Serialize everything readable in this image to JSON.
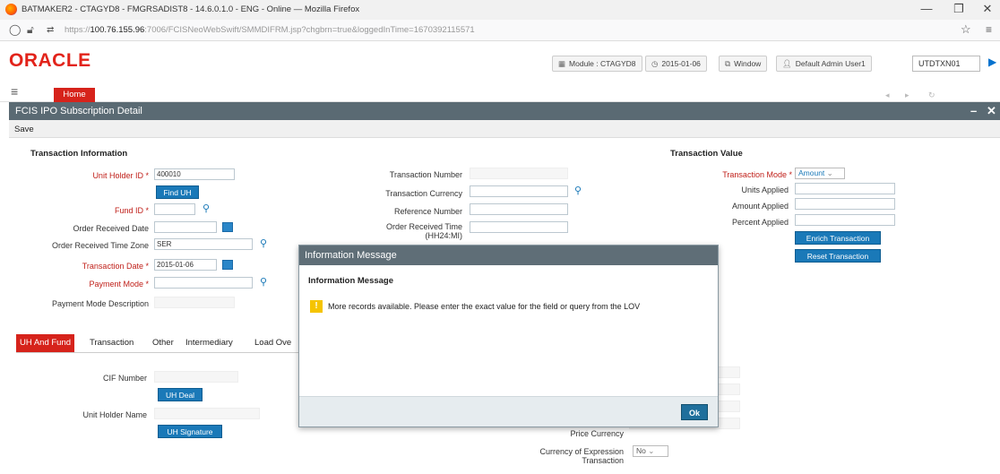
{
  "browser": {
    "window_title": "BATMAKER2 - CTAGYD8 - FMGRSADIST8 - 14.6.0.1.0 - ENG - Online — Mozilla Firefox",
    "url_prefix": "https://",
    "url_host": "100.76.155.96",
    "url_rest": ":7006/FCISNeoWebSwift/SMMDIFRM.jsp?chgbrn=true&loggedInTime=1670392115571",
    "minimize": "—",
    "maximize": "❐",
    "close": "✕"
  },
  "app": {
    "logo": "ORACLE",
    "module_label": "Module : CTAGYD8",
    "date_label": "2015-01-06",
    "window_label": "Window",
    "user_label": "Default Admin User1",
    "branch_value": "UTDTXN01",
    "home_tab": "Home"
  },
  "form": {
    "title": "FCIS IPO Subscription Detail",
    "save": "Save",
    "txn_info": {
      "heading": "Transaction Information",
      "unit_holder_id_label": "Unit Holder ID",
      "unit_holder_id_value": "400010",
      "find_uh": "Find UH",
      "fund_id_label": "Fund ID",
      "order_received_date_label": "Order Received Date",
      "order_received_tz_label": "Order Received Time Zone",
      "order_received_tz_value": "SER",
      "transaction_date_label": "Transaction Date",
      "transaction_date_value": "2015-01-06",
      "payment_mode_label": "Payment Mode",
      "payment_mode_desc_label": "Payment Mode Description"
    },
    "middle": {
      "transaction_number_label": "Transaction Number",
      "transaction_currency_label": "Transaction Currency",
      "reference_number_label": "Reference Number",
      "order_received_time_label": "Order Received Time",
      "order_received_time_sub": "(HH24:MI)"
    },
    "txn_value": {
      "heading": "Transaction Value",
      "transaction_mode_label": "Transaction Mode",
      "transaction_mode_value": "Amount",
      "units_applied_label": "Units Applied",
      "amount_applied_label": "Amount Applied",
      "percent_applied_label": "Percent Applied",
      "enrich_button": "Enrich Transaction",
      "reset_button": "Reset Transaction"
    },
    "required_star": "*",
    "subtabs": [
      "UH And Fund",
      "Transaction",
      "Other",
      "Intermediary",
      "Load Ove"
    ],
    "uh_section": {
      "cif_number_label": "CIF Number",
      "uh_deal_button": "UH Deal",
      "unit_holder_name_label": "Unit Holder Name",
      "uh_signature_button": "UH Signature",
      "price_currency_label": "Price Currency",
      "currency_expression_label_1": "Currency of Expression",
      "currency_expression_label_2": "Transaction",
      "currency_expression_value": "No"
    }
  },
  "modal": {
    "header": "Information Message",
    "title": "Information Message",
    "message": "More records available. Please enter the exact value for the field or query from the LOV",
    "ok": "Ok"
  }
}
